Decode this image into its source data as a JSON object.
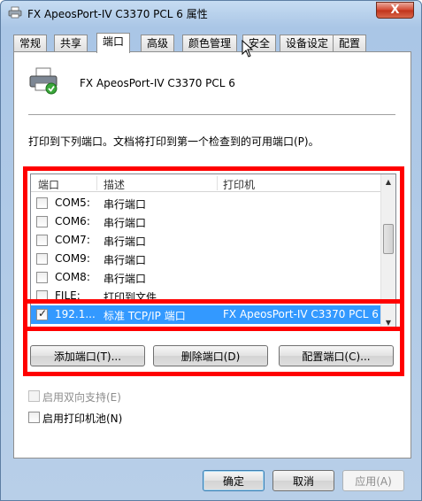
{
  "window": {
    "title": "FX ApeosPort-IV C3370 PCL 6 属性",
    "close_label": "X"
  },
  "tabs": [
    {
      "label": "常规"
    },
    {
      "label": "共享"
    },
    {
      "label": "端口"
    },
    {
      "label": "高级"
    },
    {
      "label": "颜色管理"
    },
    {
      "label": "安全"
    },
    {
      "label": "设备设定"
    },
    {
      "label": "配置"
    }
  ],
  "active_tab": "端口",
  "printer": {
    "name": "FX ApeosPort-IV C3370 PCL 6",
    "icon": "printer-icon"
  },
  "description": "打印到下列端口。文档将打印到第一个检查到的可用端口(P)。",
  "port_list": {
    "columns": [
      "端口",
      "描述",
      "打印机"
    ],
    "rows": [
      {
        "port": "COM5:",
        "desc": "串行端口",
        "printer": "",
        "checked": false
      },
      {
        "port": "COM6:",
        "desc": "串行端口",
        "printer": "",
        "checked": false
      },
      {
        "port": "COM7:",
        "desc": "串行端口",
        "printer": "",
        "checked": false
      },
      {
        "port": "COM9:",
        "desc": "串行端口",
        "printer": "",
        "checked": false
      },
      {
        "port": "COM8:",
        "desc": "串行端口",
        "printer": "",
        "checked": false
      },
      {
        "port": "FILE:",
        "desc": "打印到文件",
        "printer": "",
        "checked": false
      },
      {
        "port": "192.1...",
        "desc": "标准 TCP/IP 端口",
        "printer": "FX ApeosPort-IV C3370 PCL 6",
        "checked": true,
        "selected": true
      }
    ]
  },
  "port_buttons": {
    "add": "添加端口(T)...",
    "delete": "删除端口(D)",
    "configure": "配置端口(C)..."
  },
  "options": {
    "bidirectional": {
      "label": "启用双向支持(E)",
      "checked": false,
      "enabled": false
    },
    "pool": {
      "label": "启用打印机池(N)",
      "checked": false,
      "enabled": true
    }
  },
  "footer": {
    "ok": "确定",
    "cancel": "取消",
    "apply": "应用(A)"
  },
  "colors": {
    "selection": "#3399ff",
    "highlight_border": "#ff0000",
    "close_button": "#c9452d"
  }
}
